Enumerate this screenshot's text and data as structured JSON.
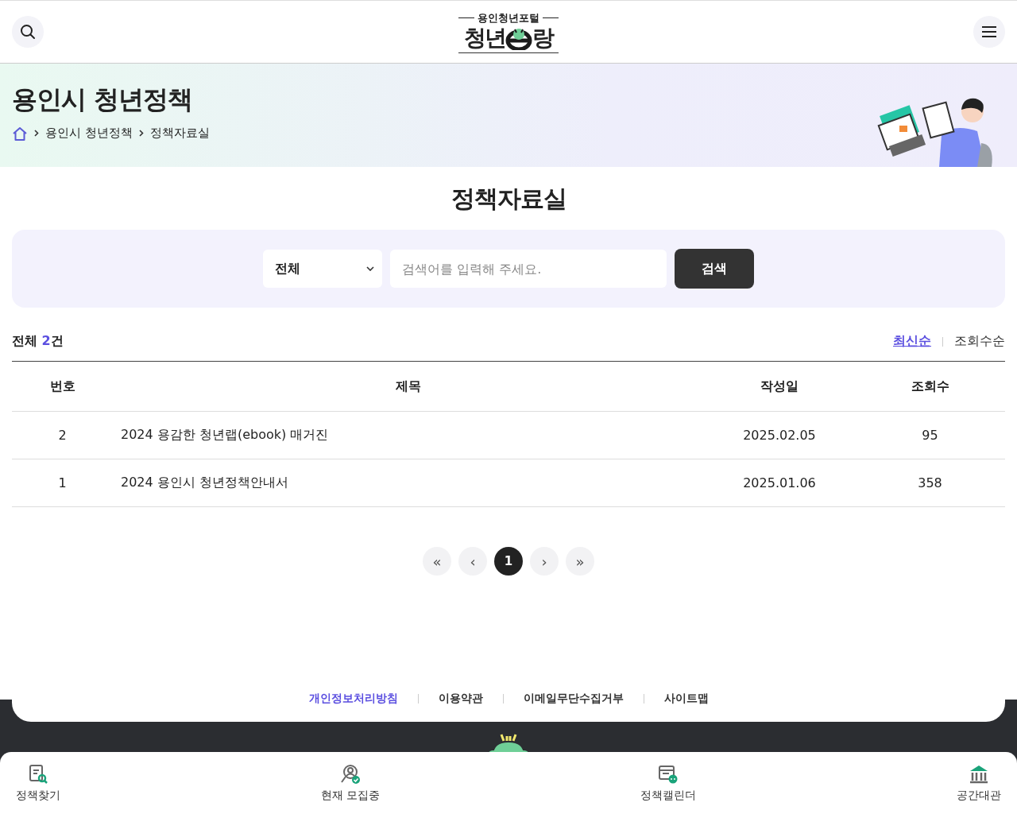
{
  "header": {
    "logo": {
      "tagline": "용인청년포털",
      "name_start": "청년",
      "name_end": "랑"
    }
  },
  "banner": {
    "title": "용인시 청년정책",
    "breadcrumb": [
      "용인시 청년정책",
      "정책자료실"
    ]
  },
  "page_title": "정책자료실",
  "search": {
    "category": "전체",
    "placeholder": "검색어를 입력해 주세요.",
    "button": "검색"
  },
  "summary": {
    "label": "전체",
    "count": "2",
    "unit": "건"
  },
  "sort": [
    {
      "label": "최신순",
      "selected": true
    },
    {
      "label": "조회수순",
      "selected": false
    }
  ],
  "table": {
    "columns": [
      "번호",
      "제목",
      "작성일",
      "조회수"
    ],
    "rows": [
      {
        "no": "2",
        "title": "2024 용감한 청년랩(ebook) 매거진",
        "date": "2025.02.05",
        "views": "95"
      },
      {
        "no": "1",
        "title": "2024 용인시 청년정책안내서",
        "date": "2025.01.06",
        "views": "358"
      }
    ]
  },
  "pagination": {
    "first": "«",
    "prev": "‹",
    "pages": [
      {
        "label": "1",
        "selected": true
      }
    ],
    "next": "›",
    "last": "»"
  },
  "footer": {
    "links": [
      {
        "label": "개인정보처리방침",
        "highlight": true
      },
      {
        "label": "이용약관",
        "highlight": false
      },
      {
        "label": "이메일무단수집거부",
        "highlight": false
      },
      {
        "label": "사이트맵",
        "highlight": false
      }
    ]
  },
  "bottom_nav": [
    {
      "kind": "search-doc",
      "label": "정책찾기"
    },
    {
      "kind": "recruit",
      "label": "현재 모집중"
    },
    {
      "kind": "calendar",
      "label": "정책캘린더"
    },
    {
      "kind": "building",
      "label": "공간대관"
    }
  ]
}
